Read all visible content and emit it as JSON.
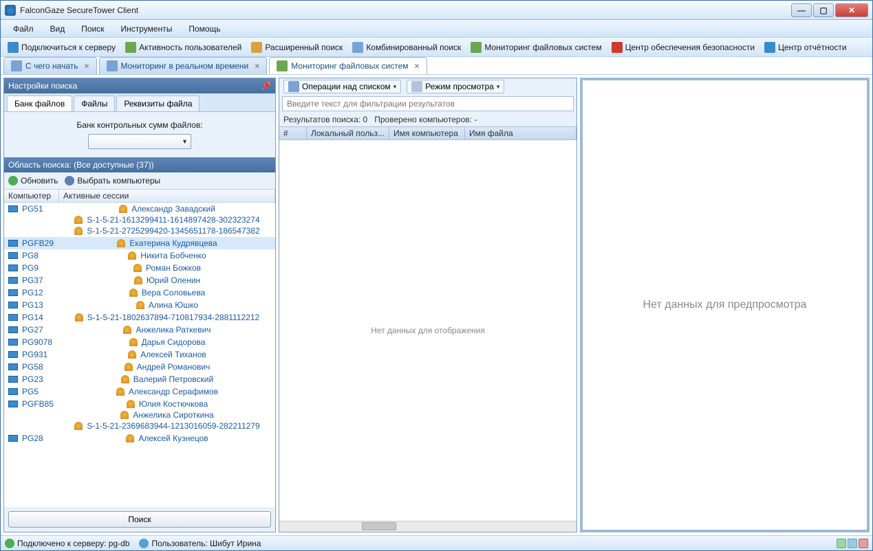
{
  "window": {
    "title": "FalconGaze SecureTower Client"
  },
  "menu": [
    "Файл",
    "Вид",
    "Поиск",
    "Инструменты",
    "Помощь"
  ],
  "toolbar": [
    {
      "label": "Подключиться к серверу",
      "color": "#3a8ccc"
    },
    {
      "label": "Активность пользователей",
      "color": "#6aa84f"
    },
    {
      "label": "Расширенный поиск",
      "color": "#d9a13b"
    },
    {
      "label": "Комбинированный поиск",
      "color": "#7aa2d4"
    },
    {
      "label": "Мониторинг файловых систем",
      "color": "#6aa84f"
    },
    {
      "label": "Центр обеспечения безопасности",
      "color": "#cc3b2e"
    },
    {
      "label": "Центр отчётности",
      "color": "#3a8ccc"
    }
  ],
  "tabs": [
    {
      "label": "С чего начать",
      "active": false
    },
    {
      "label": "Мониторинг в реальном времени",
      "active": false
    },
    {
      "label": "Мониторинг файловых систем",
      "active": true
    }
  ],
  "searchSettings": {
    "title": "Настройки поиска",
    "subtabs": [
      "Банк файлов",
      "Файлы",
      "Реквизиты файла"
    ],
    "checksumLabel": "Банк контрольных сумм файлов:"
  },
  "scope": {
    "title": "Область поиска: (Все доступные (37))",
    "refresh": "Обновить",
    "choose": "Выбрать компьютеры",
    "colComputer": "Компьютер",
    "colSessions": "Активные сессии"
  },
  "computers": [
    {
      "name": "PG51",
      "sessions": [
        "Александр Завадский",
        "S-1-5-21-1613299411-1614897428-302323274",
        "S-1-5-21-2725299420-1345651178-186547382"
      ],
      "sel": false
    },
    {
      "name": "PGFB29",
      "sessions": [
        "Екатерина Кудрявцева"
      ],
      "sel": true
    },
    {
      "name": "PG8",
      "sessions": [
        "Никита Бобченко"
      ],
      "sel": false
    },
    {
      "name": "PG9",
      "sessions": [
        "Роман Божков"
      ],
      "sel": false
    },
    {
      "name": "PG37",
      "sessions": [
        "Юрий Оленин"
      ],
      "sel": false
    },
    {
      "name": "PG12",
      "sessions": [
        "Вера Соловьева"
      ],
      "sel": false
    },
    {
      "name": "PG13",
      "sessions": [
        "Алина Юшко"
      ],
      "sel": false
    },
    {
      "name": "PG14",
      "sessions": [
        "S-1-5-21-1802637894-710817934-2881112212"
      ],
      "sel": false
    },
    {
      "name": "PG27",
      "sessions": [
        "Анжелика Раткевич"
      ],
      "sel": false
    },
    {
      "name": "PG9078",
      "sessions": [
        "Дарья Сидорова"
      ],
      "sel": false
    },
    {
      "name": "PG931",
      "sessions": [
        "Алексей Тиханов"
      ],
      "sel": false
    },
    {
      "name": "PG58",
      "sessions": [
        "Андрей Романович"
      ],
      "sel": false
    },
    {
      "name": "PG23",
      "sessions": [
        "Валерий Петровский"
      ],
      "sel": false
    },
    {
      "name": "PG5",
      "sessions": [
        "Александр Серафимов"
      ],
      "sel": false
    },
    {
      "name": "PGFB85",
      "sessions": [
        "Юлия Костючкова",
        "Анжелика Сироткина",
        "S-1-5-21-2369683944-1213016059-282211279"
      ],
      "sel": false
    },
    {
      "name": "PG28",
      "sessions": [
        "Алексей Кузнецов"
      ],
      "sel": false
    }
  ],
  "searchButton": "Поиск",
  "mid": {
    "listOps": "Операции над списком",
    "viewMode": "Режим просмотра",
    "filterPlaceholder": "Введите текст для фильтрации результатов",
    "resultsLabel": "Результатов поиска: 0",
    "checkedLabel": "Проверено компьютеров:   -",
    "cols": {
      "num": "#",
      "user": "Локальный польз...",
      "comp": "Имя компьютера",
      "file": "Имя файла"
    },
    "empty": "Нет данных для отображения"
  },
  "preview": {
    "empty": "Нет данных для предпросмотра"
  },
  "statusbar": {
    "connected": "Подключено к серверу: pg-db",
    "user": "Пользователь: Шибут Ирина"
  }
}
